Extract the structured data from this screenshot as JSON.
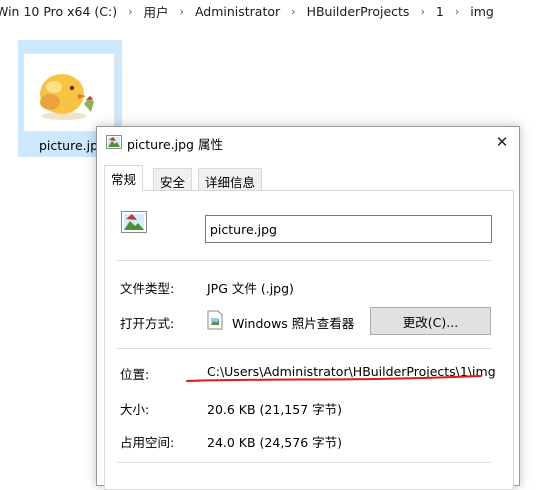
{
  "breadcrumb": [
    "Win 10 Pro x64 (C:)",
    "用户",
    "Administrator",
    "HBuilderProjects",
    "1",
    "img"
  ],
  "file": {
    "name": "picture.jpg"
  },
  "dialog": {
    "title": "picture.jpg 属性",
    "tabs": [
      "常规",
      "安全",
      "详细信息"
    ],
    "active_tab": "常规",
    "filename_value": "picture.jpg",
    "rows": {
      "type_label": "文件类型:",
      "type_value": "JPG 文件 (.jpg)",
      "open_with_label": "打开方式:",
      "open_with_value": "Windows 照片查看器",
      "change_button": "更改(C)...",
      "location_label": "位置:",
      "location_value": "C:\\Users\\Administrator\\HBuilderProjects\\1\\img",
      "size_label": "大小:",
      "size_value": "20.6 KB (21,157 字节)",
      "disk_label": "占用空间:",
      "disk_value": "24.0 KB (24,576 字节)"
    }
  },
  "colors": {
    "selection": "#cce8ff",
    "annotation": "#e0191b"
  }
}
